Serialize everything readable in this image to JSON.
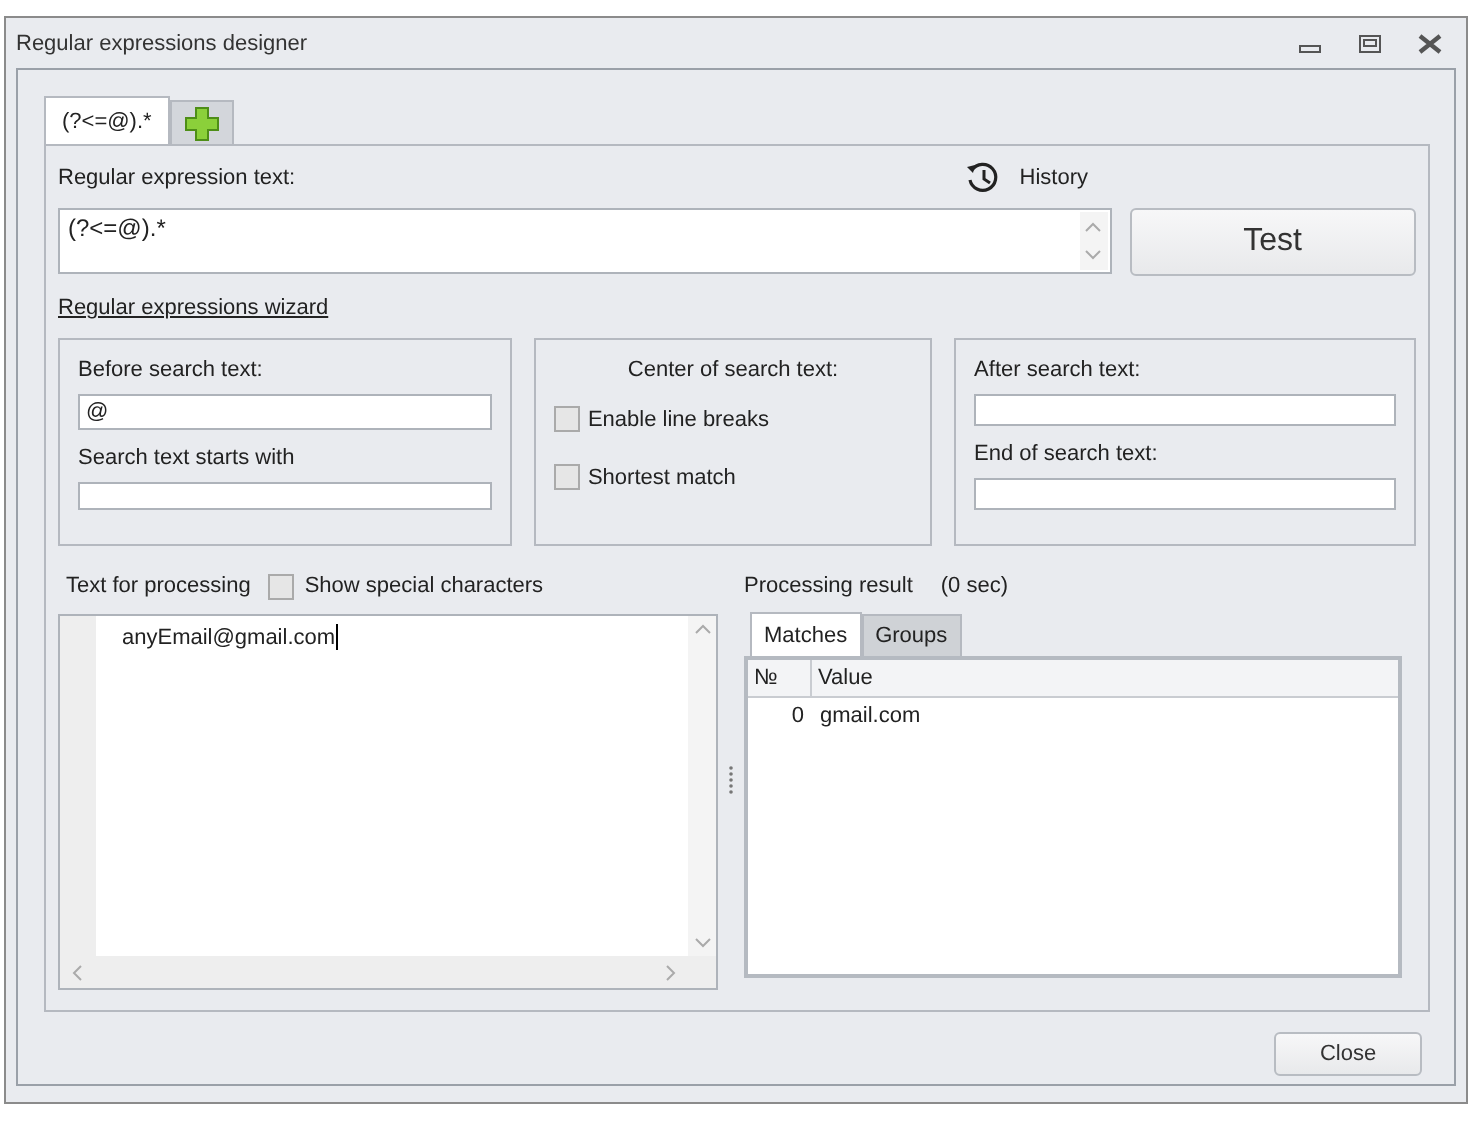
{
  "window": {
    "title": "Regular expressions designer"
  },
  "tabs": [
    {
      "label": "(?<=@).*",
      "selected": true
    }
  ],
  "expression": {
    "label": "Regular expression text:",
    "history": "History",
    "value": "(?<=@).*",
    "test_button": "Test"
  },
  "wizard_link": "Regular expressions wizard",
  "before": {
    "label": "Before search text:",
    "value": "@",
    "starts_label": "Search text starts with"
  },
  "center": {
    "label": "Center of search text:",
    "options": [
      {
        "label": "Enable line breaks",
        "checked": false
      },
      {
        "label": "Shortest match",
        "checked": false
      }
    ]
  },
  "after": {
    "label": "After search text:",
    "end_label": "End of search text:"
  },
  "processing": {
    "label": "Text for processing",
    "show_special": {
      "label": "Show special characters",
      "checked": false
    },
    "text": "anyEmail@gmail.com"
  },
  "result": {
    "label": "Processing result",
    "time": "(0 sec)",
    "tabs": [
      {
        "label": "Matches",
        "selected": true
      },
      {
        "label": "Groups",
        "selected": false
      }
    ],
    "columns": [
      "№",
      "Value"
    ],
    "rows": [
      [
        "0",
        "gmail.com"
      ]
    ]
  },
  "close_button": "Close"
}
